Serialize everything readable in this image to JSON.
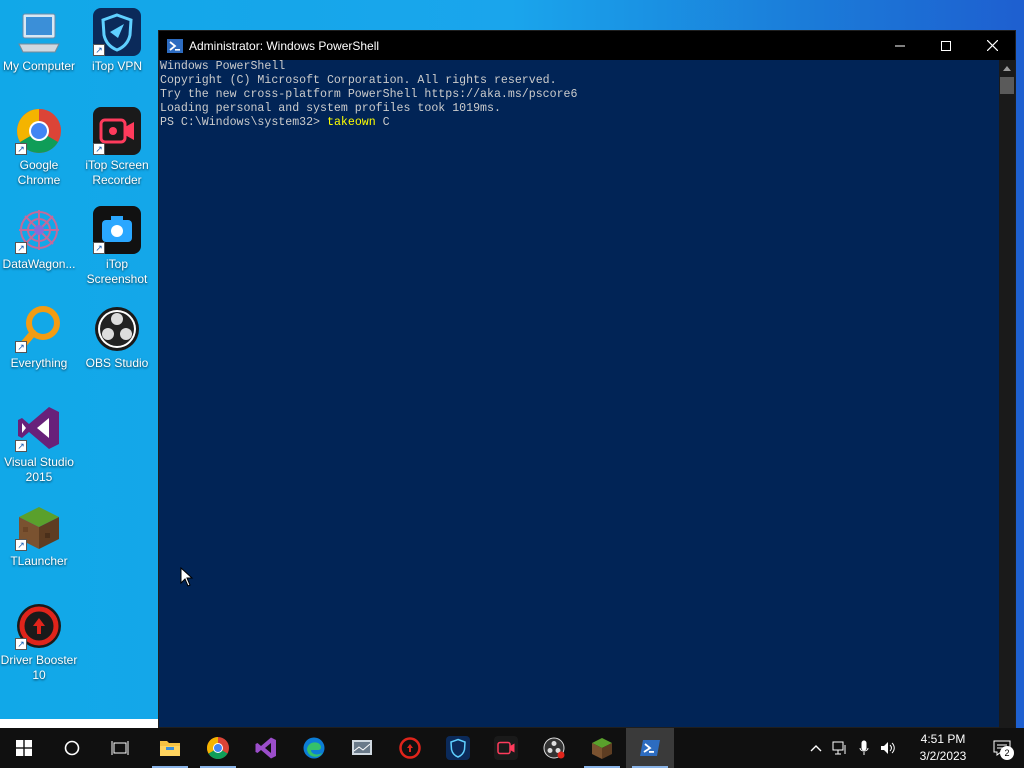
{
  "desktop": {
    "icons": [
      {
        "label": "My Computer",
        "icon": "computer-icon"
      },
      {
        "label": "iTop VPN",
        "icon": "itop-vpn-icon"
      },
      {
        "label": "Google\nChrome",
        "icon": "chrome-icon"
      },
      {
        "label": "iTop Screen\nRecorder",
        "icon": "itop-recorder-icon"
      },
      {
        "label": "DataWagon...",
        "icon": "datawagon-icon"
      },
      {
        "label": "iTop\nScreenshot",
        "icon": "itop-screenshot-icon"
      },
      {
        "label": "Everything",
        "icon": "everything-icon"
      },
      {
        "label": "OBS Studio",
        "icon": "obs-icon"
      },
      {
        "label": "Visual Studio\n2015",
        "icon": "visual-studio-icon"
      },
      {
        "label": "TLauncher",
        "icon": "tlauncher-icon"
      },
      {
        "label": "Driver Booster\n10",
        "icon": "driver-booster-icon"
      }
    ],
    "shortcut_glyph": "↗"
  },
  "window": {
    "title": "Administrator: Windows PowerShell",
    "console_lines": [
      "Windows PowerShell",
      "Copyright (C) Microsoft Corporation. All rights reserved.",
      "",
      "Try the new cross-platform PowerShell https://aka.ms/pscore6",
      "",
      "Loading personal and system profiles took 1019ms."
    ],
    "prompt": "PS C:\\Windows\\system32> ",
    "command": "takeown",
    "command_args": " C",
    "colors": {
      "background": "#012456",
      "text": "#cccccc",
      "command": "#ffff00"
    }
  },
  "taskbar": {
    "apps": [
      "start-icon",
      "search-icon",
      "task-view-icon",
      "file-explorer-icon",
      "chrome-icon",
      "visual-studio-icon",
      "edge-icon",
      "datawagon-icon",
      "driver-booster-icon",
      "itop-vpn-icon",
      "itop-recorder-icon",
      "obs-icon",
      "tlauncher-icon",
      "powershell-icon"
    ],
    "time": "4:51 PM",
    "date": "3/2/2023",
    "notifications": "2"
  }
}
